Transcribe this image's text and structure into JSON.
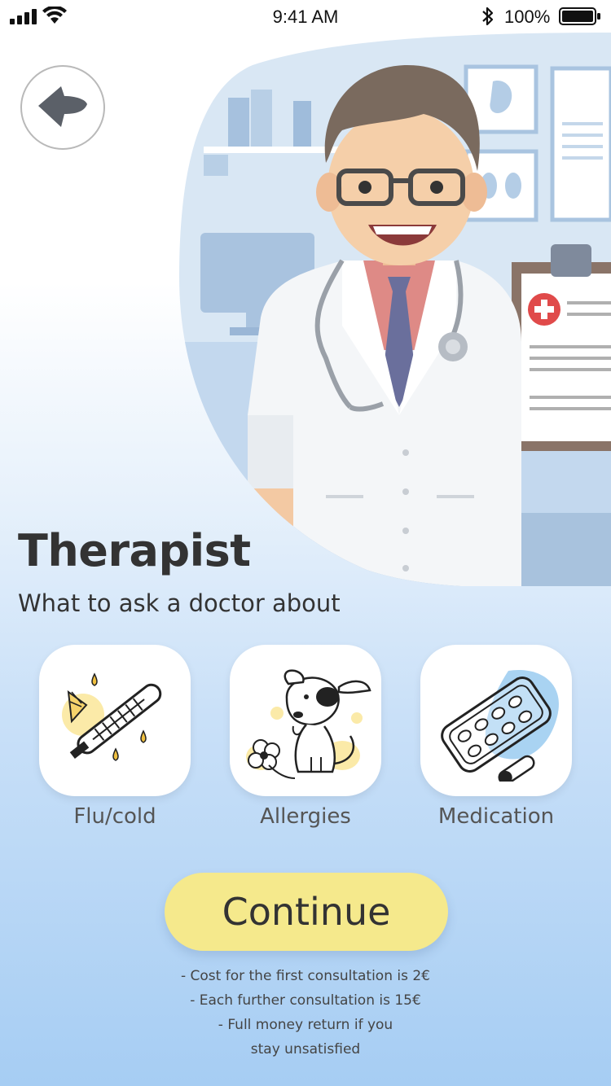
{
  "status_bar": {
    "time": "9:41 AM",
    "battery_percent": "100%",
    "icons": [
      "signal-icon",
      "wifi-icon",
      "bluetooth-icon",
      "battery-icon"
    ]
  },
  "header": {
    "back_icon": "arrow-left-icon",
    "hero_image": "doctor-illustration"
  },
  "main": {
    "title": "Therapist",
    "subtitle": "What to ask a doctor about",
    "categories": [
      {
        "label": "Flu/cold",
        "icon": "thermometer-icon"
      },
      {
        "label": "Allergies",
        "icon": "dog-flower-icon"
      },
      {
        "label": "Medication",
        "icon": "pills-icon"
      }
    ],
    "continue_label": "Continue",
    "notes": [
      "- Cost for the first consultation is 2€",
      "- Each further consultation is 15€",
      "- Full money return if you",
      "stay unsatisfied"
    ]
  },
  "colors": {
    "accent_button": "#f5e98c",
    "background_bottom": "#a6cdf3",
    "text": "#333333"
  }
}
